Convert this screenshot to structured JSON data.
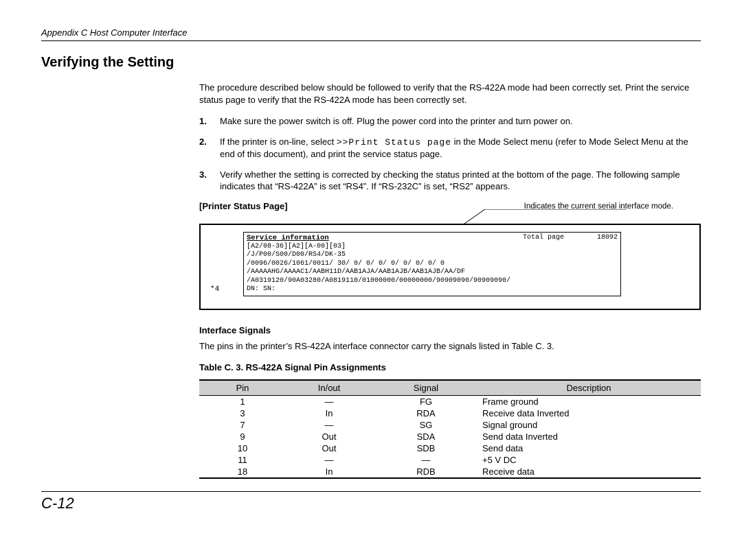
{
  "header": "Appendix C  Host Computer Interface",
  "section_title": "Verifying the Setting",
  "intro": "The procedure described below should be followed to verify that the RS-422A mode had been correctly set. Print the service status page to verify that the RS-422A mode has been correctly set.",
  "steps": [
    {
      "num": "1.",
      "text": "Make sure the power switch is off. Plug the power cord into the printer and turn power on."
    },
    {
      "num": "2.",
      "text_before": "If the printer is on-line, select ",
      "cmd": ">>Print Status page",
      "text_after": " in the Mode Select menu (refer to Mode Select Menu at the end of this document), and print the service status page."
    },
    {
      "num": "3.",
      "text": "Verify whether the setting is corrected by checking the status printed at the bottom of the page. The following sample indicates that “RS-422A” is set “RS4”. If “RS-232C” is set, “RS2” appears."
    }
  ],
  "status_label": "[Printer Status Page]",
  "callout_text": "Indicates the current serial interface mode.",
  "service_box": {
    "title": "Service information",
    "total_page_label": "Total page",
    "total_page_value": "18092",
    "lines": [
      "[A2/08-36][A2][A-00][03]",
      "/J/P00/S00/D00/RS4/DK-35",
      "/0096/0026/1061/0011/  30/  0/  0/  0/  0/  0/  0/  0/  0",
      "/AAAAAHG/AAAAC1/AABH11D/AAB1AJA/AAB1AJB/AAB1AJB/AA/DF",
      "/A0319120/90A03280/A0819110/01000000/00000000/90909090/90909090/",
      "DN:           SN:"
    ]
  },
  "star": "*4",
  "interface_heading": "Interface Signals",
  "interface_text": "The pins in the printer’s RS-422A interface connector carry the signals listed in Table C. 3.",
  "table_title": "Table C. 3.  RS-422A Signal Pin Assignments",
  "table": {
    "headers": {
      "pin": "Pin",
      "io": "In/out",
      "signal": "Signal",
      "desc": "Description"
    },
    "rows": [
      {
        "pin": "1",
        "io": "—",
        "signal": "FG",
        "desc": "Frame ground"
      },
      {
        "pin": "3",
        "io": "In",
        "signal": "RDA",
        "desc": "Receive data Inverted"
      },
      {
        "pin": "7",
        "io": "—",
        "signal": "SG",
        "desc": "Signal ground"
      },
      {
        "pin": "9",
        "io": "Out",
        "signal": "SDA",
        "desc": "Send data Inverted"
      },
      {
        "pin": "10",
        "io": "Out",
        "signal": "SDB",
        "desc": "Send data"
      },
      {
        "pin": "11",
        "io": "—",
        "signal": "—",
        "desc": "+5 V DC"
      },
      {
        "pin": "18",
        "io": "In",
        "signal": "RDB",
        "desc": "Receive data"
      }
    ]
  },
  "page_number": "C-12"
}
